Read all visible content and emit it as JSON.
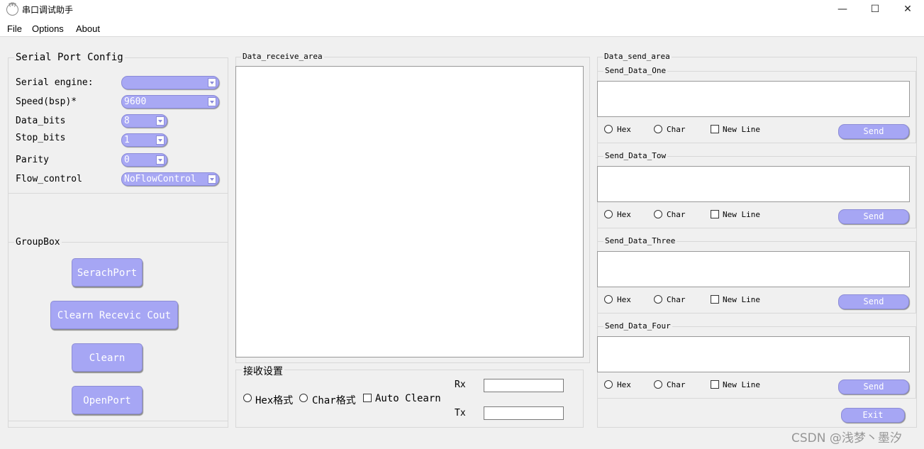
{
  "window": {
    "title": "串口调试助手",
    "minimize": "—",
    "maximize": "☐",
    "close": "✕"
  },
  "menu": [
    "File",
    "Options",
    "About"
  ],
  "serial_config": {
    "title": "Serial Port Config",
    "fields": [
      {
        "label": "Serial engine:",
        "value": ""
      },
      {
        "label": "Speed(bsp)*",
        "value": "9600"
      },
      {
        "label": "Data_bits",
        "value": "8"
      },
      {
        "label": "Stop_bits",
        "value": "1"
      },
      {
        "label": "Parity",
        "value": "0"
      },
      {
        "label": "Flow_control",
        "value": "NoFlowControl"
      }
    ]
  },
  "groupbox": {
    "title": "GroupBox",
    "buttons": [
      "SerachPort",
      "Clearn Recevic Cout",
      "Clearn",
      "OpenPort"
    ]
  },
  "receive": {
    "title": "Data_receive_area",
    "text": "",
    "settings_title": "接收设置",
    "hex_label": "Hex格式",
    "char_label": "Char格式",
    "auto_clear_label": "Auto Clearn",
    "rx_label": "Rx",
    "tx_label": "Tx",
    "rx_value": "",
    "tx_value": ""
  },
  "send_area": {
    "title": "Data_send_area",
    "groups": [
      {
        "title": "Send_Data_One",
        "text": "",
        "hex": "Hex",
        "char": "Char",
        "newline": "New Line",
        "send": "Send"
      },
      {
        "title": "Send_Data_Tow",
        "text": "",
        "hex": "Hex",
        "char": "Char",
        "newline": "New Line",
        "send": "Send"
      },
      {
        "title": "Send_Data_Three",
        "text": "",
        "hex": "Hex",
        "char": "Char",
        "newline": "New Line",
        "send": "Send"
      },
      {
        "title": "Send_Data_Four",
        "text": "",
        "hex": "Hex",
        "char": "Char",
        "newline": "New Line",
        "send": "Send"
      }
    ],
    "exit": "Exit"
  },
  "watermark": "CSDN @浅梦丶墨汐",
  "colors": {
    "button": "#a6a6f4",
    "button_border": "#8c8cd6",
    "background": "#f0f0f0"
  }
}
